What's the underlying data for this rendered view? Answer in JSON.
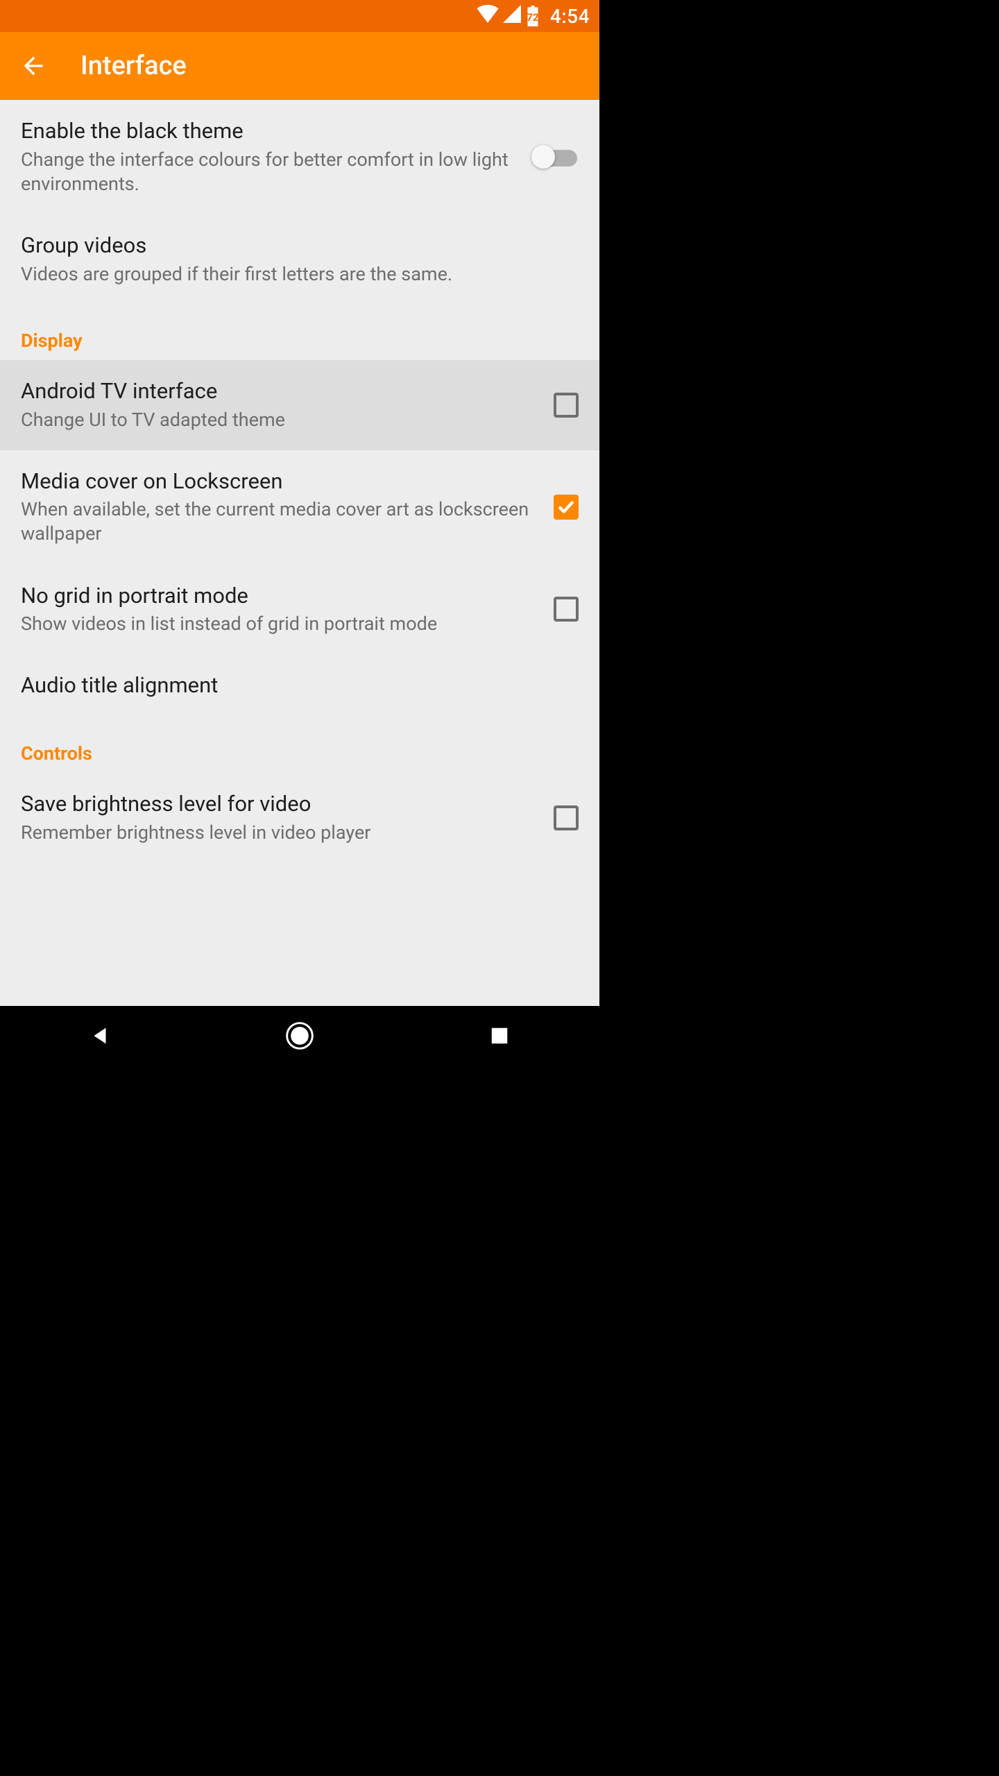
{
  "statusbar": {
    "battery_level": "72",
    "clock": "4:54"
  },
  "appbar": {
    "title": "Interface"
  },
  "settings": [
    {
      "title": "Enable the black theme",
      "subtitle": "Change the interface colours for better comfort in low light environments.",
      "control": "switch",
      "checked": false
    },
    {
      "title": "Group videos",
      "subtitle": "Videos are grouped if their first letters are the same.",
      "control": "none"
    }
  ],
  "section_display": "Display",
  "display_settings": [
    {
      "title": "Android TV interface",
      "subtitle": "Change UI to TV adapted theme",
      "control": "checkbox",
      "checked": false,
      "highlight": true
    },
    {
      "title": "Media cover on Lockscreen",
      "subtitle": "When available, set the current media cover art as lockscreen wallpaper",
      "control": "checkbox",
      "checked": true
    },
    {
      "title": "No grid in portrait mode",
      "subtitle": "Show videos in list instead of grid in portrait mode",
      "control": "checkbox",
      "checked": false
    },
    {
      "title": "Audio title alignment",
      "subtitle": "",
      "control": "none"
    }
  ],
  "section_controls": "Controls",
  "controls_settings": [
    {
      "title": "Save brightness level for video",
      "subtitle": "Remember brightness level in video player",
      "control": "checkbox",
      "checked": false
    }
  ]
}
